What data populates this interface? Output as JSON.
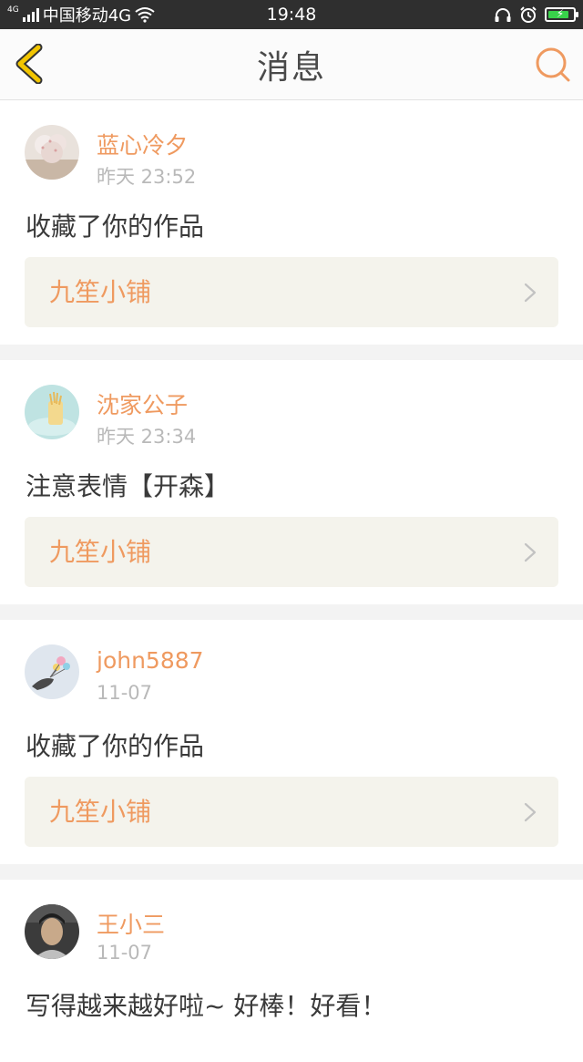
{
  "status_bar": {
    "network_type": "4G",
    "carrier": "中国移动4G",
    "time": "19:48",
    "battery_color": "#38d24a",
    "battery_level": 0.85
  },
  "nav": {
    "title": "消息"
  },
  "colors": {
    "accent": "#ef9a60",
    "back_icon": "#f2c500"
  },
  "messages": [
    {
      "username": "蓝心冷夕",
      "time": "昨天 23:52",
      "text": "收藏了你的作品",
      "work_title": "九笙小铺"
    },
    {
      "username": "沈家公子",
      "time": "昨天 23:34",
      "text": "注意表情【开森】",
      "work_title": "九笙小铺"
    },
    {
      "username": "john5887",
      "time": "11-07",
      "text": "收藏了你的作品",
      "work_title": "九笙小铺"
    },
    {
      "username": "王小三",
      "time": "11-07",
      "text": "写得越来越好啦~ 好棒！好看！"
    }
  ]
}
